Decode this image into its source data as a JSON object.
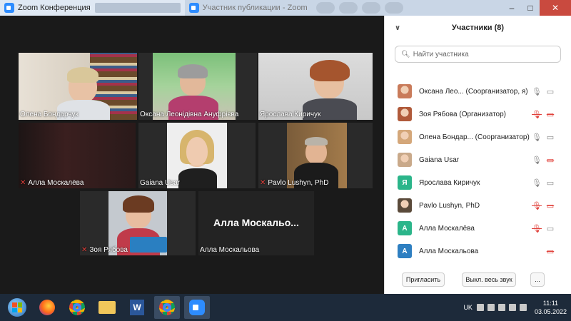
{
  "titlebar": {
    "app_title": "Zoom Конференция",
    "second_tab": "Участник публикации - Zoom"
  },
  "tiles": [
    {
      "name": "Олена Бондарчук",
      "muted": false,
      "speaking": true
    },
    {
      "name": "Оксана Леонідівна Ануфрієва",
      "muted": false,
      "speaking": false
    },
    {
      "name": "Ярослава Киричук",
      "muted": false,
      "speaking": false
    },
    {
      "name": "Алла Москалёва",
      "muted": true,
      "speaking": false
    },
    {
      "name": "Gaiana Usar",
      "muted": false,
      "speaking": false
    },
    {
      "name": "Pavlo Lushyn, PhD",
      "muted": true,
      "speaking": false
    },
    {
      "name": "Зоя Рябова",
      "muted": true,
      "speaking": false
    },
    {
      "name": "Алла Москальова",
      "muted": false,
      "speaking": false,
      "placeholder": "Алла  Москальо..."
    }
  ],
  "panel": {
    "title": "Участники (8)",
    "search_placeholder": "Найти участника",
    "participants": [
      {
        "name": "Оксана Лео... (Соорганизатор, я)",
        "avatar": "photo",
        "mic": "on",
        "cam": "on"
      },
      {
        "name": "Зоя Рябова (Организатор)",
        "avatar": "photo",
        "mic": "off",
        "cam": "off"
      },
      {
        "name": "Олена Бондар... (Соорганизатор)",
        "avatar": "photo",
        "mic": "on",
        "cam": "on"
      },
      {
        "name": "Gaiana Usar",
        "avatar": "photo",
        "mic": "on",
        "cam": "off"
      },
      {
        "name": "Ярослава Киричук",
        "avatar": "Я",
        "avatar_color": "#2bb58a",
        "mic": "on",
        "cam": "on"
      },
      {
        "name": "Pavlo Lushyn, PhD",
        "avatar": "photo",
        "mic": "off",
        "cam": "off"
      },
      {
        "name": "Алла Москалёва",
        "avatar": "A",
        "avatar_color": "#2bb58a",
        "mic": "off",
        "cam": "on"
      },
      {
        "name": "Алла Москальова",
        "avatar": "A",
        "avatar_color": "#2e7fc1",
        "mic": "none",
        "cam": "off"
      }
    ],
    "invite_label": "Пригласить",
    "mute_all_label": "Выкл. весь звук",
    "more_label": "..."
  },
  "taskbar": {
    "language": "UK",
    "time": "11:11",
    "date": "03.05.2022"
  },
  "colors": {
    "zoom_blue": "#2d8cff",
    "muted_red": "#e0403a",
    "active_speaker": "#d7e75a"
  }
}
